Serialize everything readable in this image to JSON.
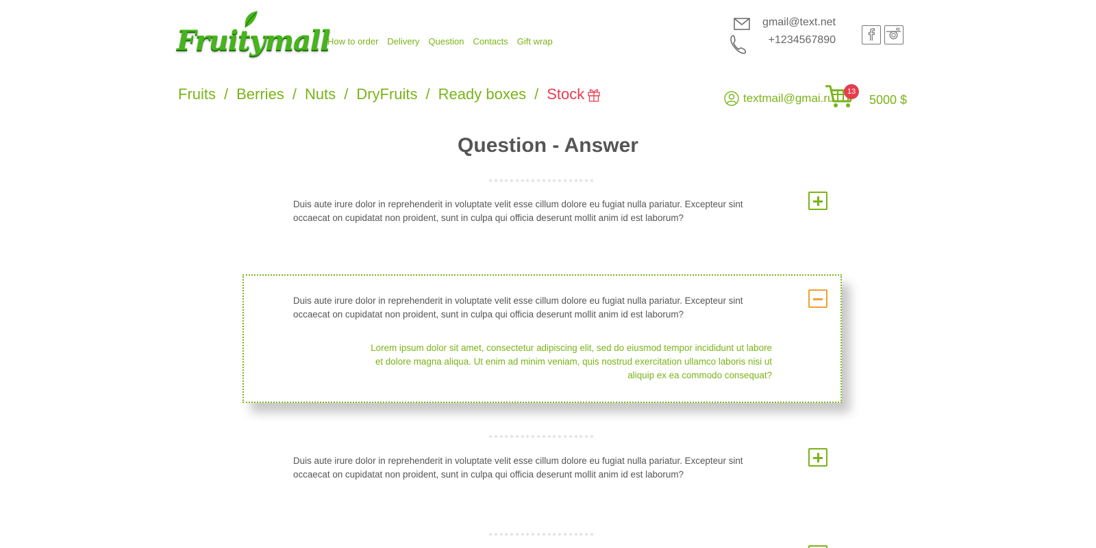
{
  "header": {
    "logo_text": "Fruitymall",
    "top_nav": [
      "How to order",
      "Delivery",
      "Question",
      "Contacts",
      "Gift wrap"
    ],
    "email": "gmail@text.net",
    "phone": "+1234567890",
    "social": [
      "facebook-icon",
      "instagram-icon"
    ]
  },
  "categories": {
    "items": [
      "Fruits",
      "Berries",
      "Nuts",
      "DryFruits",
      "Ready boxes",
      "Stock"
    ],
    "separator": "/",
    "stock_color": "#e73c4e",
    "accent_color": "#7ab317"
  },
  "account": {
    "email": "textmail@gmai.ru",
    "cart_count": "13",
    "total": "5000 $"
  },
  "page": {
    "title": "Question - Answer"
  },
  "faq": [
    {
      "question": "Duis aute irure dolor in reprehenderit in voluptate velit esse cillum dolore eu fugiat nulla pariatur. Excepteur sint occaecat on cupidatat non proident, sunt in culpa qui officia deserunt mollit anim id est laborum?",
      "expanded": false
    },
    {
      "question": "Duis aute irure dolor in reprehenderit in voluptate velit esse cillum dolore eu fugiat nulla pariatur. Excepteur sint occaecat on cupidatat non proident, sunt in culpa qui officia deserunt mollit anim id est laborum?",
      "answer": "Lorem ipsum dolor sit amet, consectetur adipiscing elit, sed do eiusmod tempor incididunt ut labore et dolore magna aliqua. Ut enim ad minim veniam, quis nostrud exercitation ullamco laboris nisi ut aliquip ex ea commodo consequat?",
      "expanded": true
    },
    {
      "question": "Duis aute irure dolor in reprehenderit in voluptate velit esse cillum dolore eu fugiat nulla pariatur. Excepteur sint occaecat on cupidatat non proident, sunt in culpa qui officia deserunt mollit anim id est laborum?",
      "expanded": false
    }
  ]
}
